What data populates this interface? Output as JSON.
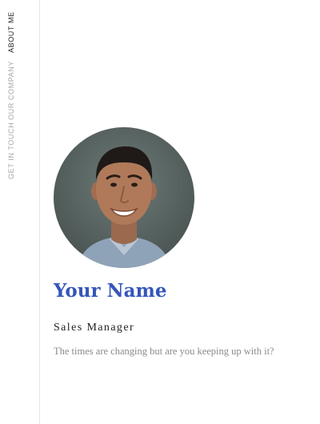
{
  "nav": {
    "items": [
      {
        "label": "ABOUT ME",
        "active": true
      },
      {
        "label": "OUR COMPANY",
        "active": false
      },
      {
        "label": "GET IN TOUCH",
        "active": false
      }
    ]
  },
  "profile": {
    "name": "Your Name",
    "title": "Sales Manager",
    "tagline": "The times are changing but are you keeping up with it?",
    "photo": "profile-photo"
  },
  "colors": {
    "accent": "#3556b8",
    "nav_inactive": "#a7a7a7",
    "nav_active": "#222222",
    "muted_text": "#8a8a8a",
    "divider": "#e6e6e6"
  }
}
